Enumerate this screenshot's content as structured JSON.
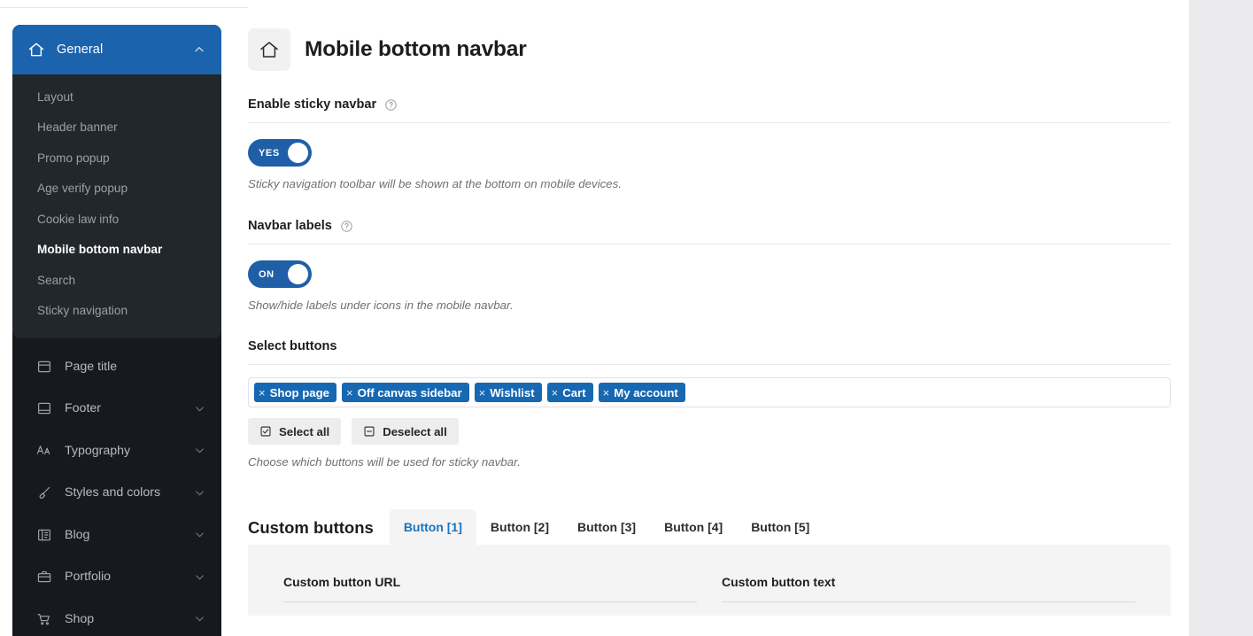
{
  "sidebar": {
    "group": {
      "label": "General",
      "icon": "home-icon",
      "chevron": "chevron-up-icon",
      "accent_color": "#1c63ad",
      "submenu": [
        {
          "label": "Layout",
          "active": false
        },
        {
          "label": "Header banner",
          "active": false
        },
        {
          "label": "Promo popup",
          "active": false
        },
        {
          "label": "Age verify popup",
          "active": false
        },
        {
          "label": "Cookie law info",
          "active": false
        },
        {
          "label": "Mobile bottom navbar",
          "active": true
        },
        {
          "label": "Search",
          "active": false
        },
        {
          "label": "Sticky navigation",
          "active": false
        }
      ]
    },
    "items": [
      {
        "label": "Page title",
        "icon": "page-title-icon",
        "chevron": false
      },
      {
        "label": "Footer",
        "icon": "footer-icon",
        "chevron": true
      },
      {
        "label": "Typography",
        "icon": "typography-icon",
        "chevron": true
      },
      {
        "label": "Styles and colors",
        "icon": "brush-icon",
        "chevron": true
      },
      {
        "label": "Blog",
        "icon": "blog-icon",
        "chevron": true
      },
      {
        "label": "Portfolio",
        "icon": "briefcase-icon",
        "chevron": true
      },
      {
        "label": "Shop",
        "icon": "cart-icon",
        "chevron": true
      }
    ]
  },
  "page": {
    "title": "Mobile bottom navbar",
    "icon": "home-icon"
  },
  "sticky_navbar": {
    "label": "Enable sticky navbar",
    "help_icon": "help-circle-icon",
    "toggle_value": "YES",
    "toggle_on": true,
    "description": "Sticky navigation toolbar will be shown at the bottom on mobile devices."
  },
  "navbar_labels": {
    "label": "Navbar labels",
    "help_icon": "help-circle-icon",
    "toggle_value": "ON",
    "toggle_on": true,
    "description": "Show/hide labels under icons in the mobile navbar."
  },
  "select_buttons": {
    "label": "Select buttons",
    "chips": [
      {
        "label": "Shop page",
        "remove_icon": "close-icon"
      },
      {
        "label": "Off canvas sidebar",
        "remove_icon": "close-icon"
      },
      {
        "label": "Wishlist",
        "remove_icon": "close-icon"
      },
      {
        "label": "Cart",
        "remove_icon": "close-icon"
      },
      {
        "label": "My account",
        "remove_icon": "close-icon"
      }
    ],
    "select_all_label": "Select all",
    "select_all_icon": "checked-square-icon",
    "deselect_all_label": "Deselect all",
    "deselect_all_icon": "minus-square-icon",
    "description": "Choose which buttons will be used for sticky navbar.",
    "chip_color": "#1668b3"
  },
  "custom_buttons": {
    "title": "Custom buttons",
    "tabs": [
      {
        "label": "Button [1]",
        "active": true
      },
      {
        "label": "Button [2]",
        "active": false
      },
      {
        "label": "Button [3]",
        "active": false
      },
      {
        "label": "Button [4]",
        "active": false
      },
      {
        "label": "Button [5]",
        "active": false
      }
    ],
    "active_tab_color": "#1a73bd",
    "fields": [
      {
        "label": "Custom button URL",
        "value": "",
        "placeholder": ""
      },
      {
        "label": "Custom button text",
        "value": "",
        "placeholder": ""
      }
    ]
  }
}
